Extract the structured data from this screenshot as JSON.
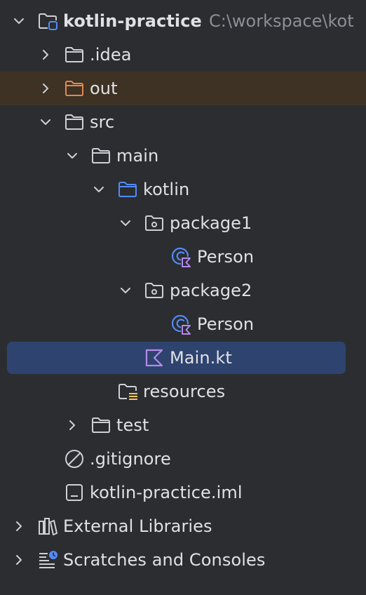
{
  "tree": {
    "root": {
      "label": "kotlin-practice",
      "path": "C:\\workspace\\kot"
    },
    "idea": {
      "label": ".idea"
    },
    "out": {
      "label": "out"
    },
    "src": {
      "label": "src"
    },
    "main": {
      "label": "main"
    },
    "kotlin": {
      "label": "kotlin"
    },
    "package1": {
      "label": "package1"
    },
    "package1_person": {
      "label": "Person"
    },
    "package2": {
      "label": "package2"
    },
    "package2_person": {
      "label": "Person"
    },
    "main_kt": {
      "label": "Main.kt"
    },
    "resources": {
      "label": "resources"
    },
    "test": {
      "label": "test"
    },
    "gitignore": {
      "label": ".gitignore"
    },
    "iml": {
      "label": "kotlin-practice.iml"
    },
    "external_libraries": {
      "label": "External Libraries"
    },
    "scratches": {
      "label": "Scratches and Consoles"
    }
  },
  "colors": {
    "background": "#2b2d30",
    "selected_row": "#2e436e",
    "excluded_row": "#3d3223",
    "folder": "#ced0d6",
    "source_root_folder": "#548af7",
    "excluded_folder": "#e08855",
    "kotlin_accent": "#b589ec",
    "class_accent": "#548af7",
    "path_text": "#8c8f95"
  }
}
